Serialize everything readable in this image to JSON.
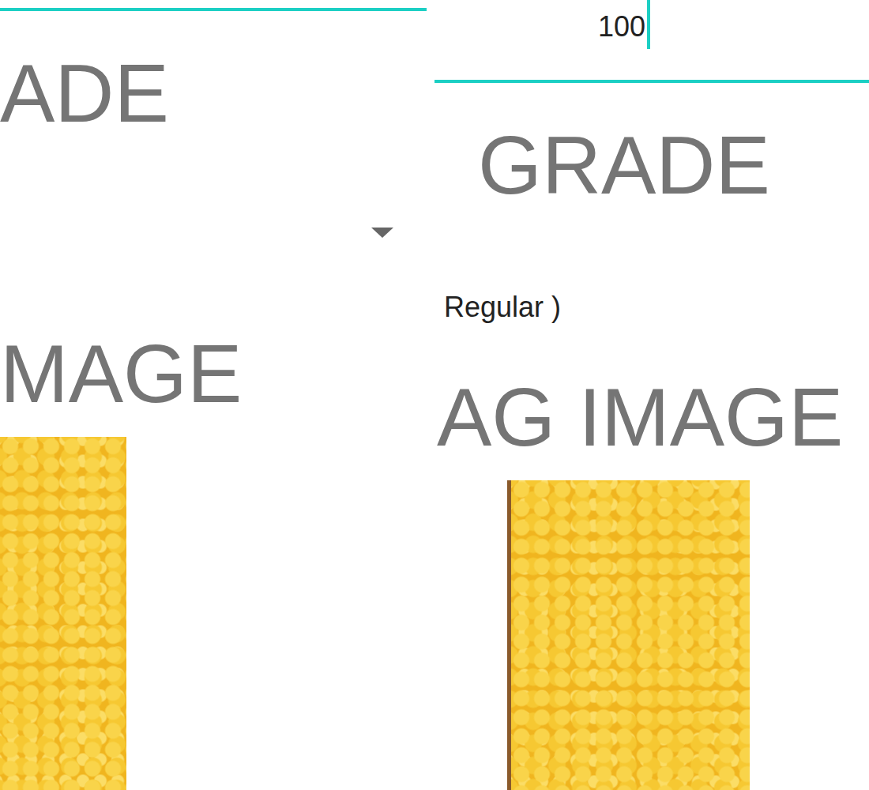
{
  "panels": [
    {
      "items": [
        {
          "kind": "line"
        },
        {
          "kind": "heading",
          "text": "ADE"
        },
        {
          "kind": "dropdown"
        },
        {
          "kind": "heading",
          "text": "MAGE"
        },
        {
          "kind": "photo"
        }
      ]
    },
    {
      "items": [
        {
          "kind": "field",
          "value": "100",
          "focused": true
        },
        {
          "kind": "line"
        },
        {
          "kind": "heading",
          "text": "GRADE"
        },
        {
          "kind": "text",
          "text": "Regular )"
        },
        {
          "kind": "heading",
          "text": "AG IMAGE"
        },
        {
          "kind": "photo"
        }
      ]
    }
  ]
}
